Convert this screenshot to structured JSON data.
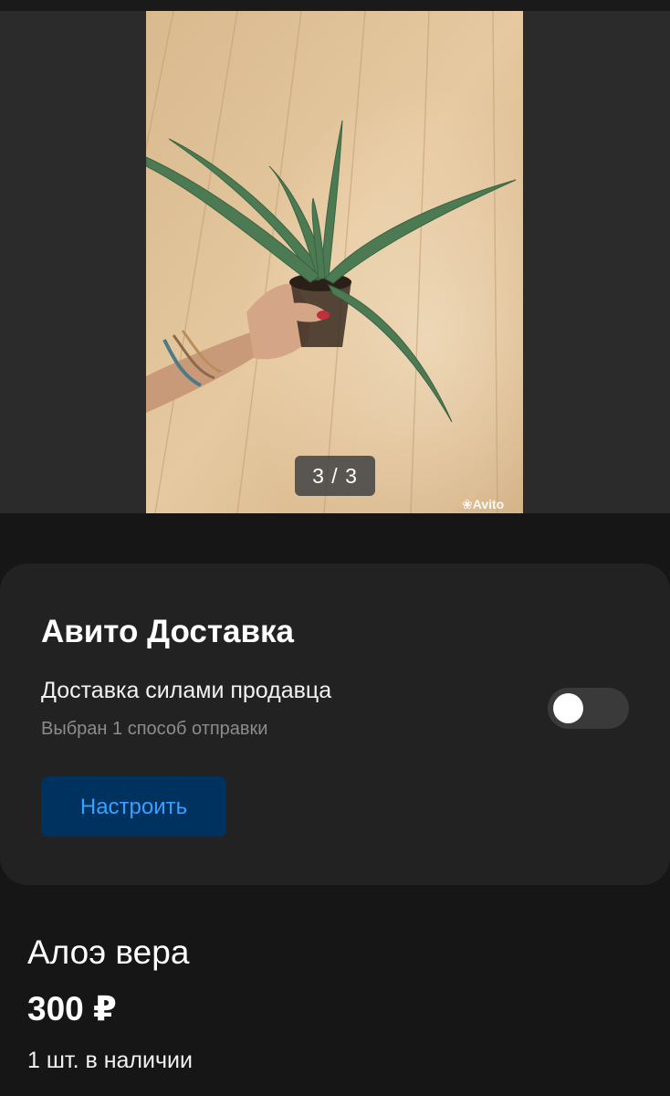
{
  "gallery": {
    "counter": "3 / 3",
    "watermark": "Avito",
    "photo_icon": "aloe-plant-photo"
  },
  "delivery": {
    "title": "Авито Доставка",
    "option_label": "Доставка силами продавца",
    "option_sub": "Выбран 1 способ отправки",
    "toggle_on": false,
    "configure_label": "Настроить"
  },
  "product": {
    "title": "Алоэ вера",
    "price": "300 ₽",
    "stock": "1 шт. в наличии"
  },
  "colors": {
    "background": "#161616",
    "card": "#222222",
    "button_bg": "#00325f",
    "button_text": "#3aa0ff",
    "toggle_track": "#3a3a3a"
  }
}
